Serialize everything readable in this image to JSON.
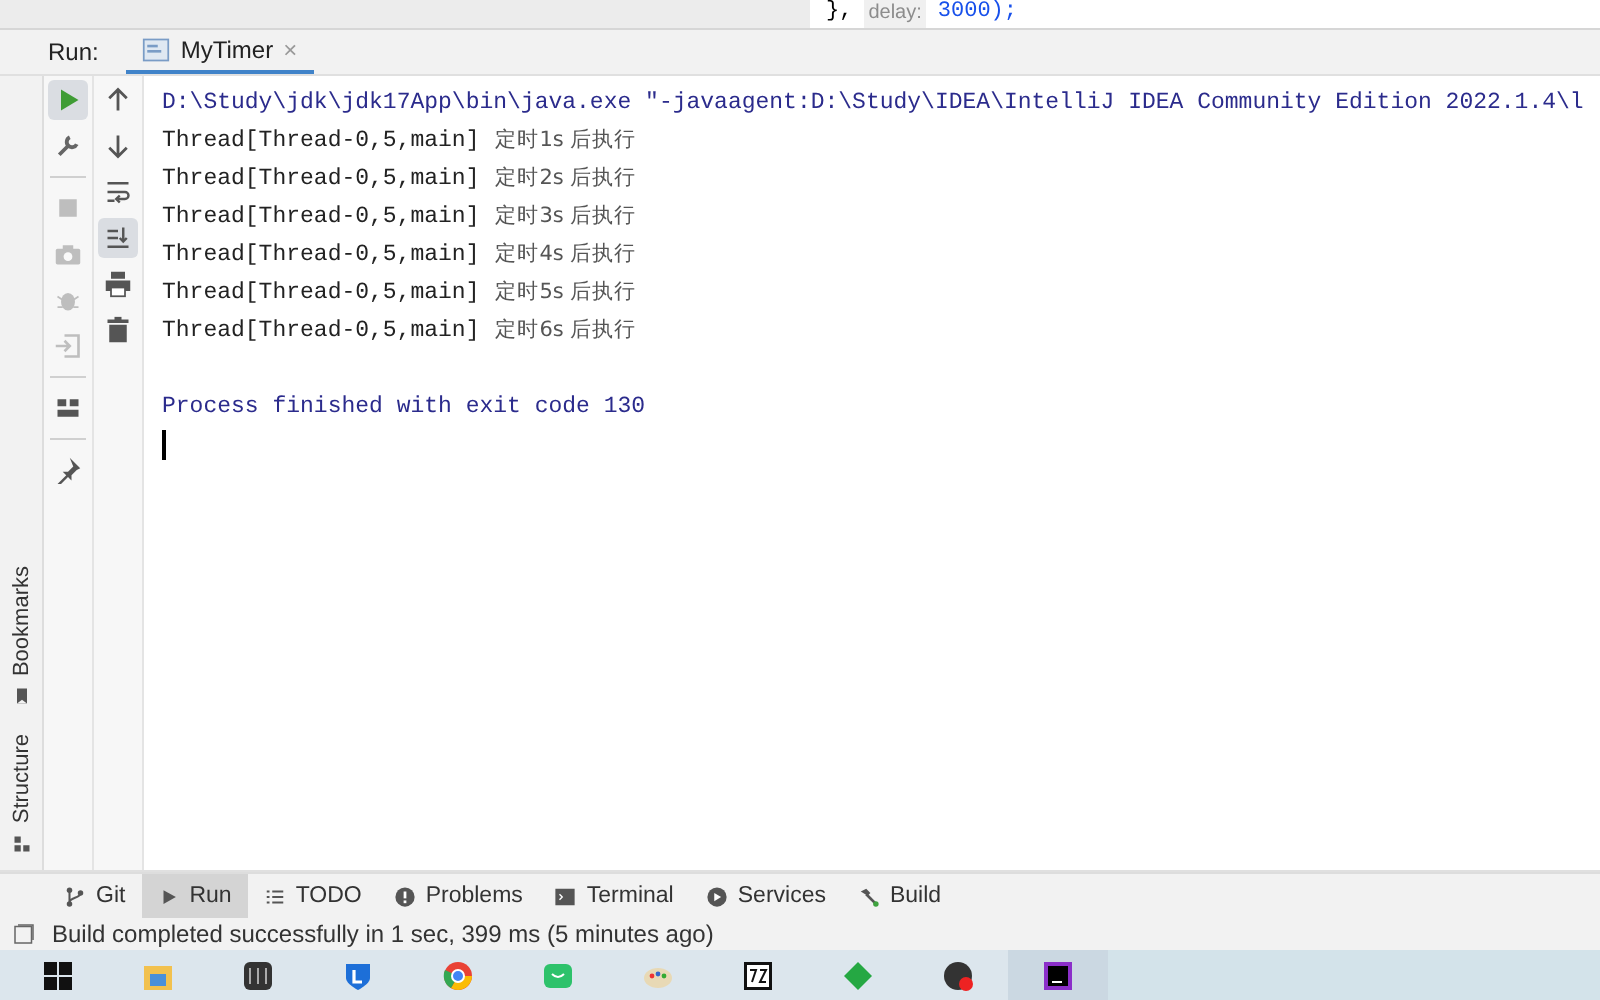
{
  "editor_snippet": {
    "code": "},",
    "hint": "delay:",
    "value": "3000);"
  },
  "run_panel": {
    "label": "Run:",
    "tab": {
      "title": "MyTimer",
      "close": "×",
      "selected": true
    }
  },
  "side_stripe": [
    {
      "label": "Bookmarks"
    },
    {
      "label": "Structure"
    }
  ],
  "run_toolbar": [
    {
      "active": true,
      "disabled": false
    },
    {
      "active": false,
      "disabled": false
    },
    {
      "active": false,
      "disabled": true
    },
    {
      "active": false,
      "disabled": true
    },
    {
      "active": false,
      "disabled": true
    },
    {
      "active": false,
      "disabled": true
    },
    {
      "active": false,
      "disabled": false
    },
    {
      "active": false,
      "disabled": false
    }
  ],
  "console_toolbar": [
    {
      "active": false
    },
    {
      "active": false
    },
    {
      "active": false
    },
    {
      "active": true
    },
    {
      "active": false
    },
    {
      "active": false
    }
  ],
  "console": {
    "command": "D:\\Study\\jdk\\jdk17App\\bin\\java.exe \"-javaagent:D:\\Study\\IDEA\\IntelliJ IDEA Community Edition 2022.1.4\\l",
    "lines": [
      {
        "thread": "Thread[Thread-0,5,main]",
        "message": "定时1s 后执行"
      },
      {
        "thread": "Thread[Thread-0,5,main]",
        "message": "定时2s 后执行"
      },
      {
        "thread": "Thread[Thread-0,5,main]",
        "message": "定时3s 后执行"
      },
      {
        "thread": "Thread[Thread-0,5,main]",
        "message": "定时4s 后执行"
      },
      {
        "thread": "Thread[Thread-0,5,main]",
        "message": "定时5s 后执行"
      },
      {
        "thread": "Thread[Thread-0,5,main]",
        "message": "定时6s 后执行"
      }
    ],
    "exit": "Process finished with exit code 130"
  },
  "tool_tabs": [
    {
      "label": "Git",
      "selected": false
    },
    {
      "label": "Run",
      "selected": true
    },
    {
      "label": "TODO",
      "selected": false
    },
    {
      "label": "Problems",
      "selected": false
    },
    {
      "label": "Terminal",
      "selected": false
    },
    {
      "label": "Services",
      "selected": false
    },
    {
      "label": "Build",
      "selected": false
    }
  ],
  "status_bar": {
    "message": "Build completed successfully in 1 sec, 399 ms (5 minutes ago)"
  },
  "taskbar": [
    {
      "selected": false
    },
    {
      "selected": false
    },
    {
      "selected": false
    },
    {
      "selected": false
    },
    {
      "selected": false
    },
    {
      "selected": false
    },
    {
      "selected": false
    },
    {
      "selected": false
    },
    {
      "selected": false
    },
    {
      "selected": false
    },
    {
      "selected": true
    }
  ]
}
